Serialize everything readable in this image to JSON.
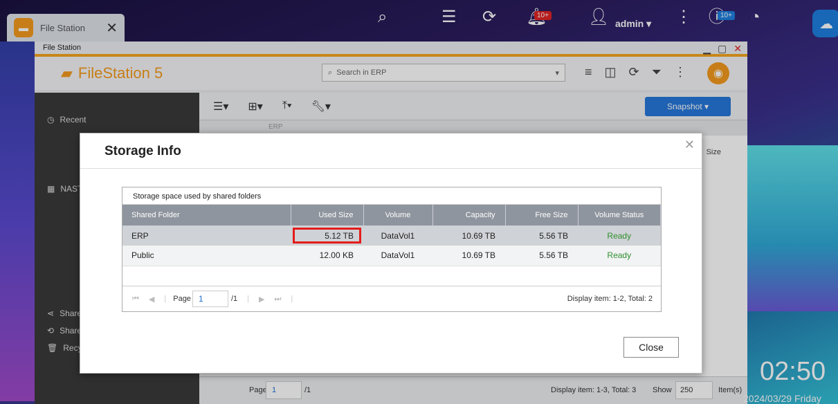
{
  "taskbar": {
    "tab_label": "File Station",
    "tab_icon": "folder-icon",
    "close_glyph": "✕"
  },
  "topbar": {
    "notif_badge": "10+",
    "user": "admin",
    "ext_badge": "10+"
  },
  "window": {
    "title": "File Station",
    "app_name": "FileStation 5",
    "search_placeholder": "Search in ERP"
  },
  "sidebar": {
    "items": [
      "Recent",
      "NAST",
      "Share",
      "Share",
      "Recy"
    ]
  },
  "toolbar": {
    "snapshot_label": "Snapshot ▾"
  },
  "pathbar": {
    "path": "ERP"
  },
  "right_header": {
    "size_col": "Size"
  },
  "bottombar": {
    "page_label": "Page",
    "page_value": "1",
    "page_total": "/1",
    "display_info": "Display item: 1-3, Total: 3",
    "show_label": "Show",
    "show_value": "250",
    "items_label": "Item(s)"
  },
  "clock": {
    "time": "02:50",
    "date": "2024/03/29 Friday"
  },
  "dialog": {
    "title": "Storage Info",
    "panel_caption": "Storage space used by shared folders",
    "columns": [
      "Shared Folder",
      "Used Size",
      "Volume",
      "Capacity",
      "Free Size",
      "Volume Status"
    ],
    "rows": [
      {
        "folder": "ERP",
        "used": "5.12 TB",
        "volume": "DataVol1",
        "capacity": "10.69 TB",
        "free": "5.56 TB",
        "status": "Ready"
      },
      {
        "folder": "Public",
        "used": "12.00 KB",
        "volume": "DataVol1",
        "capacity": "10.69 TB",
        "free": "5.56 TB",
        "status": "Ready"
      }
    ],
    "pager": {
      "page_label": "Page",
      "page_value": "1",
      "page_total": "/1",
      "info": "Display item: 1-2, Total: 2"
    },
    "close_label": "Close"
  },
  "colors": {
    "accent": "#f39a1e",
    "snapshot_blue": "#2677d9",
    "ready_green": "#2f8f2f",
    "highlight_red": "#e41b1b"
  }
}
